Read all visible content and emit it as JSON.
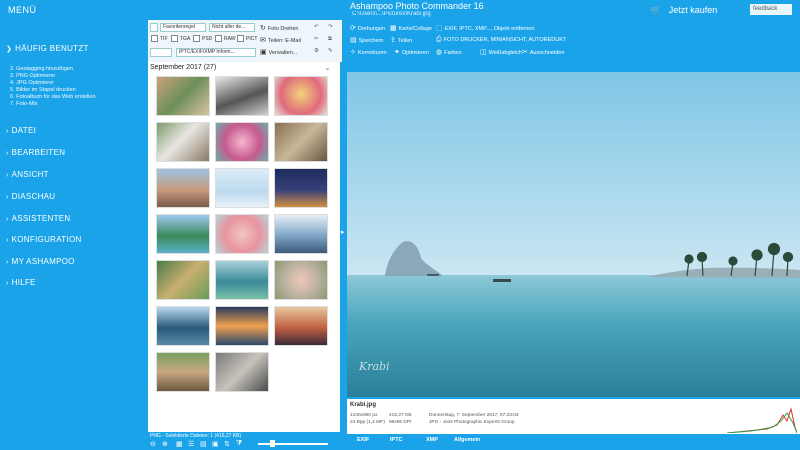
{
  "app": {
    "menu": "MENÜ",
    "title": "Ashampoo Photo Commander 16",
    "path": "C:\\Users\\...\\Pictures\\Krabi.jpg",
    "cart": "Jetzt kaufen",
    "user": "feedback"
  },
  "sidebar": {
    "sections": [
      {
        "label": "HÄUFIG BENUTZT",
        "items": [
          "2. Geotagging hinzufügen",
          "3. PNG Optimierer",
          "4. JPG Optimierer",
          "5. Bilder im Stapel drucken",
          "6. Fotoalbum für das Web erstellen",
          "7. Foto-Mix"
        ]
      },
      {
        "label": "DATEI"
      },
      {
        "label": "BEARBEITEN"
      },
      {
        "label": "ANSICHT"
      },
      {
        "label": "DIASCHAU"
      },
      {
        "label": "ASSISTENTEN"
      },
      {
        "label": "KONFIGURATION"
      },
      {
        "label": "MY ASHAMPOO"
      },
      {
        "label": "HILFE"
      }
    ]
  },
  "filters": {
    "sort_select": "Favoritenregel",
    "filter_select": "Nicht aller de...",
    "search_value": "IPTC/EXIF/XMP Inform...",
    "checkboxes": [
      "TIF",
      "TGA",
      "PSD",
      "RAW",
      "PICT"
    ],
    "actions": [
      "Foto Drehen",
      "Teilen: E-Mail",
      "Verwalten..."
    ]
  },
  "toolbar": {
    "row1": [
      "Drehungen",
      "Karte/Collage",
      "EXIF, IPTC, XMP..., Objekt entfernen"
    ],
    "row2": [
      "Speichern",
      "Teilen",
      "FOTO DRUCKEN, MINIANSICHT, AUTOREDUKT"
    ],
    "row3": [
      "Korrekturen",
      "Optimieren",
      "Farben",
      "Weißabgleich",
      "Ausschneiden"
    ]
  },
  "thumbs": {
    "folder": "September 2017 (27)",
    "status": "PNG - Selektierte Dateien: 1 (416,27 KB)"
  },
  "info": {
    "filename": "Krabi.jpg",
    "dims": "1440x960 px",
    "bpp": "24 Bpp (1,4 MP)",
    "size": "416,27 KB",
    "dpi": "96x96 DPI",
    "date": "Donnerstag, 7. September 2017, 07:23:04",
    "format": "JPG - Joint Photographic Experts Group"
  },
  "tabs": [
    "EXIF",
    "IPTC",
    "XMP",
    "Allgemein"
  ],
  "colors": {
    "accent": "#1aa3e8",
    "pane": "#ffffff"
  }
}
